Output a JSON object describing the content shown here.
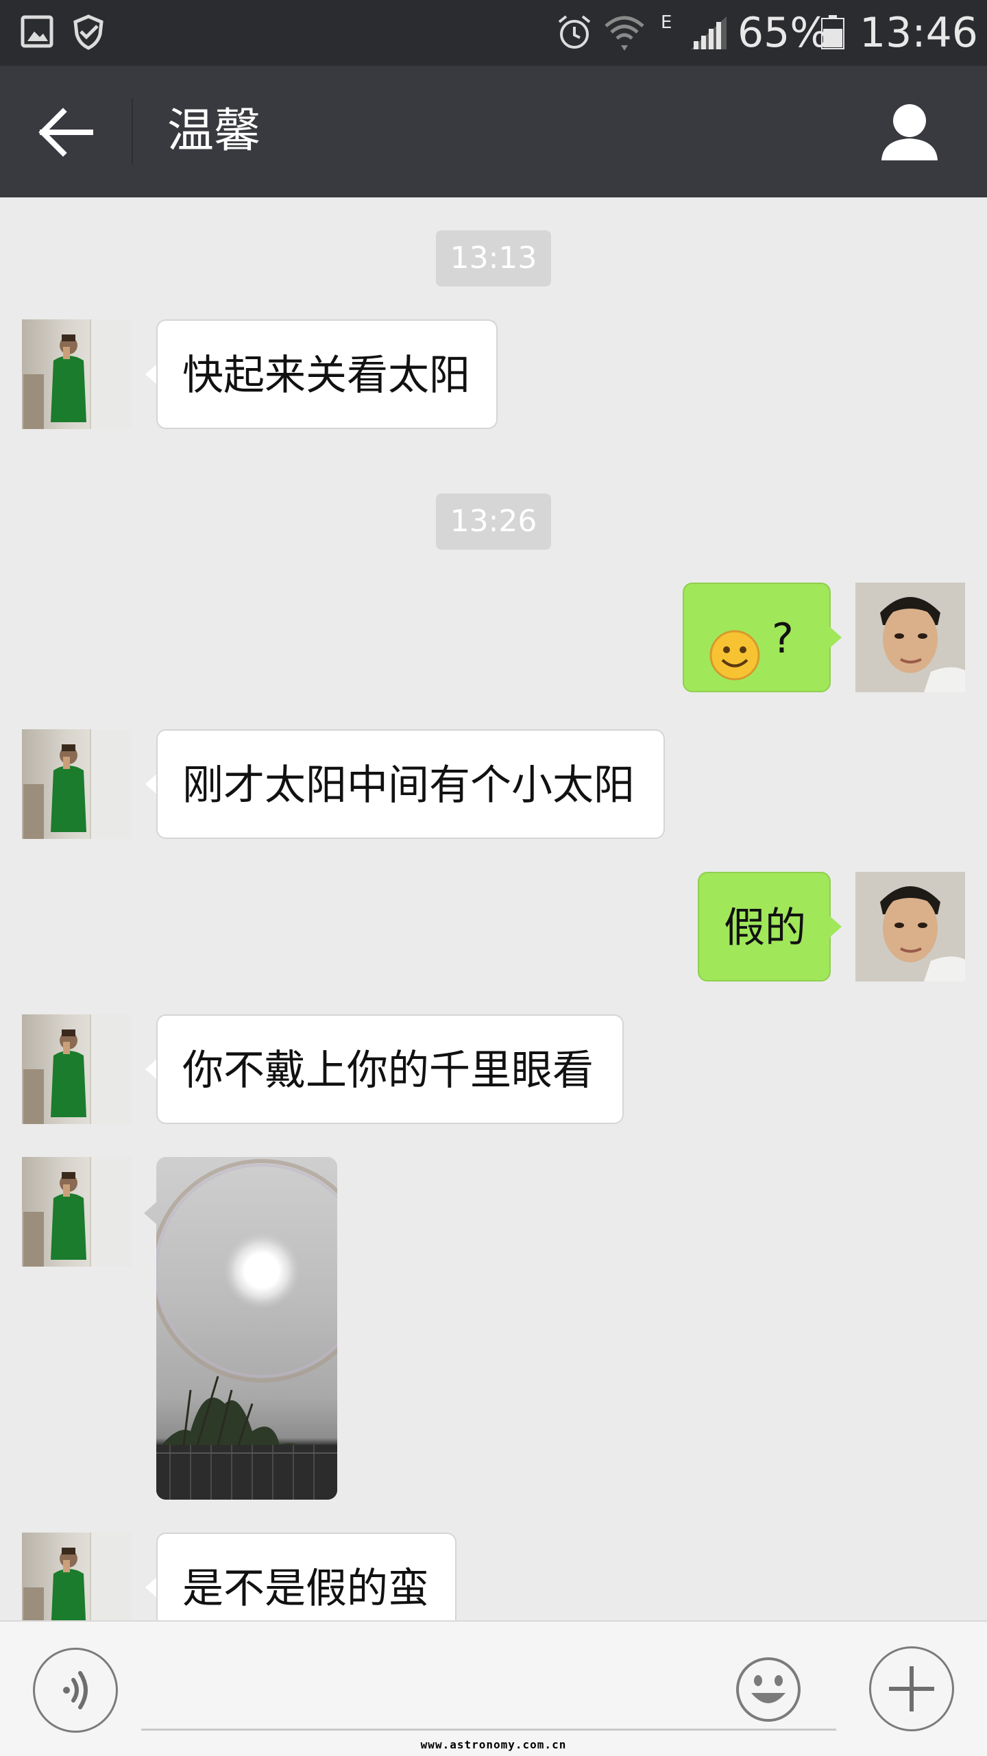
{
  "status_bar": {
    "battery": "65%",
    "time": "13:46",
    "network": "E",
    "icons": [
      "gallery-icon",
      "shield-check-icon",
      "alarm-icon",
      "wifi-icon",
      "signal-icon",
      "battery-icon"
    ]
  },
  "header": {
    "title": "温馨",
    "back_icon": "back-arrow-icon",
    "profile_icon": "person-icon"
  },
  "messages": [
    {
      "type": "timestamp",
      "text": "13:13"
    },
    {
      "type": "text",
      "from": "other",
      "text": "快起来关看太阳"
    },
    {
      "type": "timestamp",
      "text": "13:26"
    },
    {
      "type": "emoji_text",
      "from": "me",
      "emoji": "smiley",
      "text": "?"
    },
    {
      "type": "text",
      "from": "other",
      "text": "刚才太阳中间有个小太阳"
    },
    {
      "type": "text",
      "from": "me",
      "text": "假的"
    },
    {
      "type": "text",
      "from": "other",
      "text": "你不戴上你的千里眼看"
    },
    {
      "type": "image",
      "from": "other",
      "content": "sun-halo-photo"
    },
    {
      "type": "text",
      "from": "other",
      "text": "是不是假的蛮"
    }
  ],
  "input_bar": {
    "value": "",
    "voice_icon": "voice-icon",
    "emoji_icon": "smiley-icon",
    "more_icon": "plus-icon"
  },
  "watermark": "www.astronomy.com.cn",
  "colors": {
    "status_bar_bg": "#2b2c30",
    "title_bar_bg": "#393a3f",
    "chat_bg": "#ebebeb",
    "outgoing_bubble": "#a0e75a",
    "incoming_bubble": "#ffffff"
  }
}
